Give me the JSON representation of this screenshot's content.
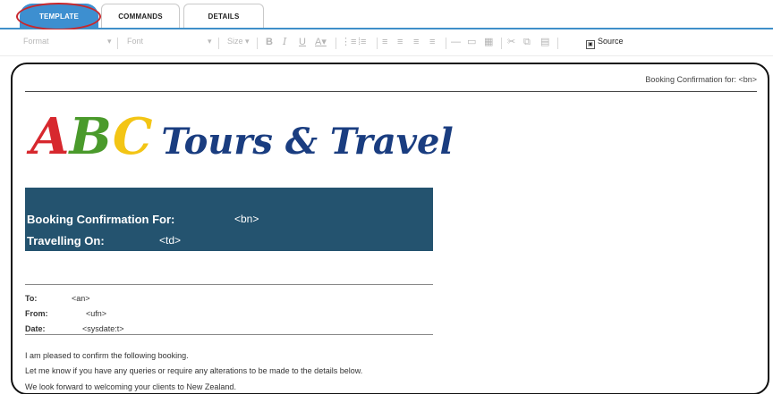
{
  "tabs": [
    {
      "label": "TEMPLATE",
      "active": true
    },
    {
      "label": "COMMANDS",
      "active": false
    },
    {
      "label": "DETAILS",
      "active": false
    }
  ],
  "toolbar": {
    "format": "Format",
    "font": "Font",
    "size": "Size",
    "source": "Source",
    "icons": [
      "bold-icon",
      "italic-icon",
      "underline-icon",
      "text-color-icon",
      "numbered-list-icon",
      "bulleted-list-icon",
      "align-left-icon",
      "align-center-icon",
      "align-right-icon",
      "justify-icon",
      "horizontal-line-icon",
      "image-icon",
      "table-icon",
      "cut-icon",
      "copy-icon",
      "paste-icon",
      "source-icon"
    ]
  },
  "document": {
    "booking_top": "Booking Confirmation  for: <bn>",
    "logo": {
      "a": "A",
      "b": "B",
      "c": "C",
      "rest": "Tours & Travel"
    },
    "banner": {
      "booking_label": "Booking Confirmation For:",
      "booking_value": "<bn>",
      "travel_label": "Travelling On:",
      "travel_value": "<td>"
    },
    "meta": [
      {
        "label": "To:",
        "value": "<an>"
      },
      {
        "label": "From:",
        "value": "<ufn>"
      },
      {
        "label": "Date:",
        "value": "<sysdate:t>"
      }
    ],
    "body": [
      "I am pleased to confirm the following booking.",
      "Let me know if you have any queries or require any alterations to be made to the details below.",
      "We look forward to welcoming your clients to New Zealand."
    ]
  },
  "colors": {
    "accent": "#3d8fd0",
    "banner": "#24536f",
    "highlight_ring": "#c8282d"
  }
}
